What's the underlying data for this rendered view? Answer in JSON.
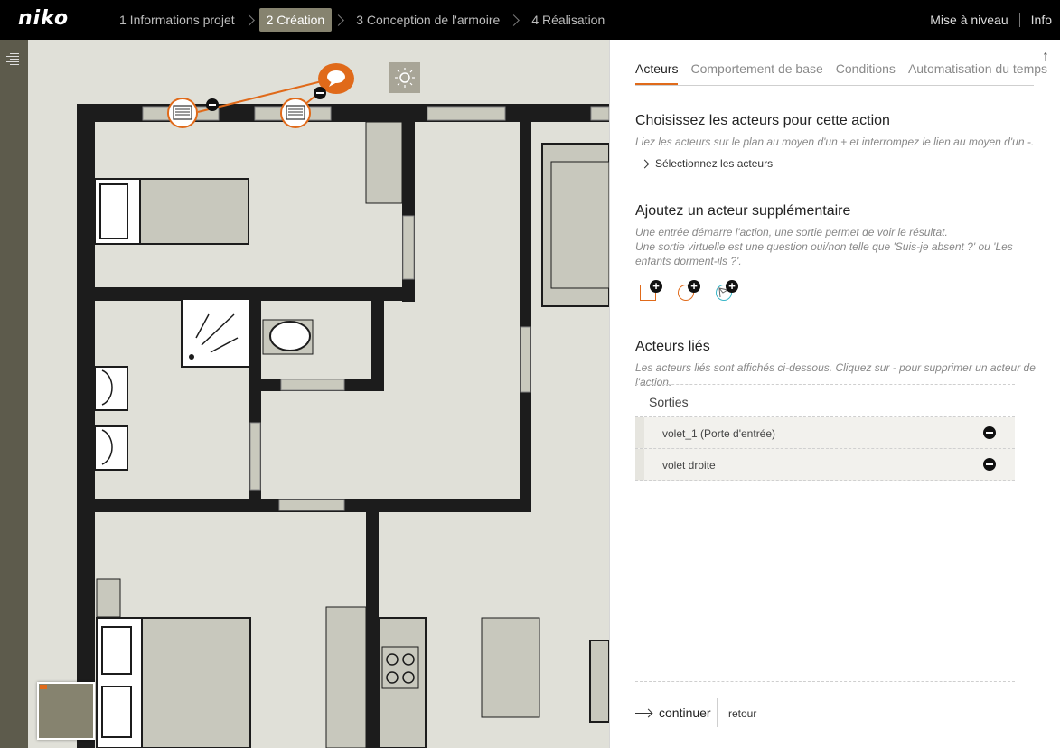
{
  "app": {
    "logo": "niko"
  },
  "steps": [
    {
      "label": "1 Informations projet",
      "active": false
    },
    {
      "label": "2 Création",
      "active": true
    },
    {
      "label": "3 Conception de l'armoire",
      "active": false
    },
    {
      "label": "4 Réalisation",
      "active": false
    }
  ],
  "topright": {
    "upgrade": "Mise à niveau",
    "info": "Info"
  },
  "tabs": [
    {
      "label": "Acteurs",
      "active": true
    },
    {
      "label": "Comportement de base",
      "active": false
    },
    {
      "label": "Conditions",
      "active": false
    },
    {
      "label": "Automatisation du temps",
      "active": false
    }
  ],
  "choose": {
    "title": "Choisissez les acteurs pour cette action",
    "hint": "Liez les acteurs sur le plan au moyen d'un + et interrompez le lien au moyen d'un -.",
    "link": "Sélectionnez les acteurs"
  },
  "add": {
    "title": "Ajoutez un acteur supplémentaire",
    "hint1": "Une entrée démarre l'action, une sortie permet de voir le résultat.",
    "hint2": "Une sortie virtuelle est une question oui/non telle que 'Suis-je absent ?' ou 'Les",
    "hint3": "enfants dorment-ils ?'.",
    "icons": [
      "add-input-icon",
      "add-output-icon",
      "add-virtual-output-icon"
    ]
  },
  "linked": {
    "title": "Acteurs liés",
    "hint": "Les acteurs liés sont affichés ci-dessous. Cliquez sur - pour supprimer un acteur de l'action.",
    "group": "Sorties",
    "items": [
      "volet_1 (Porte d'entrée)",
      "volet droite"
    ]
  },
  "footer": {
    "continue": "continuer",
    "back": "retour"
  },
  "colors": {
    "accent": "#e06a1a",
    "active_step": "#86836f",
    "wall": "#1c1c1c",
    "floor": "#e0e0d8"
  }
}
